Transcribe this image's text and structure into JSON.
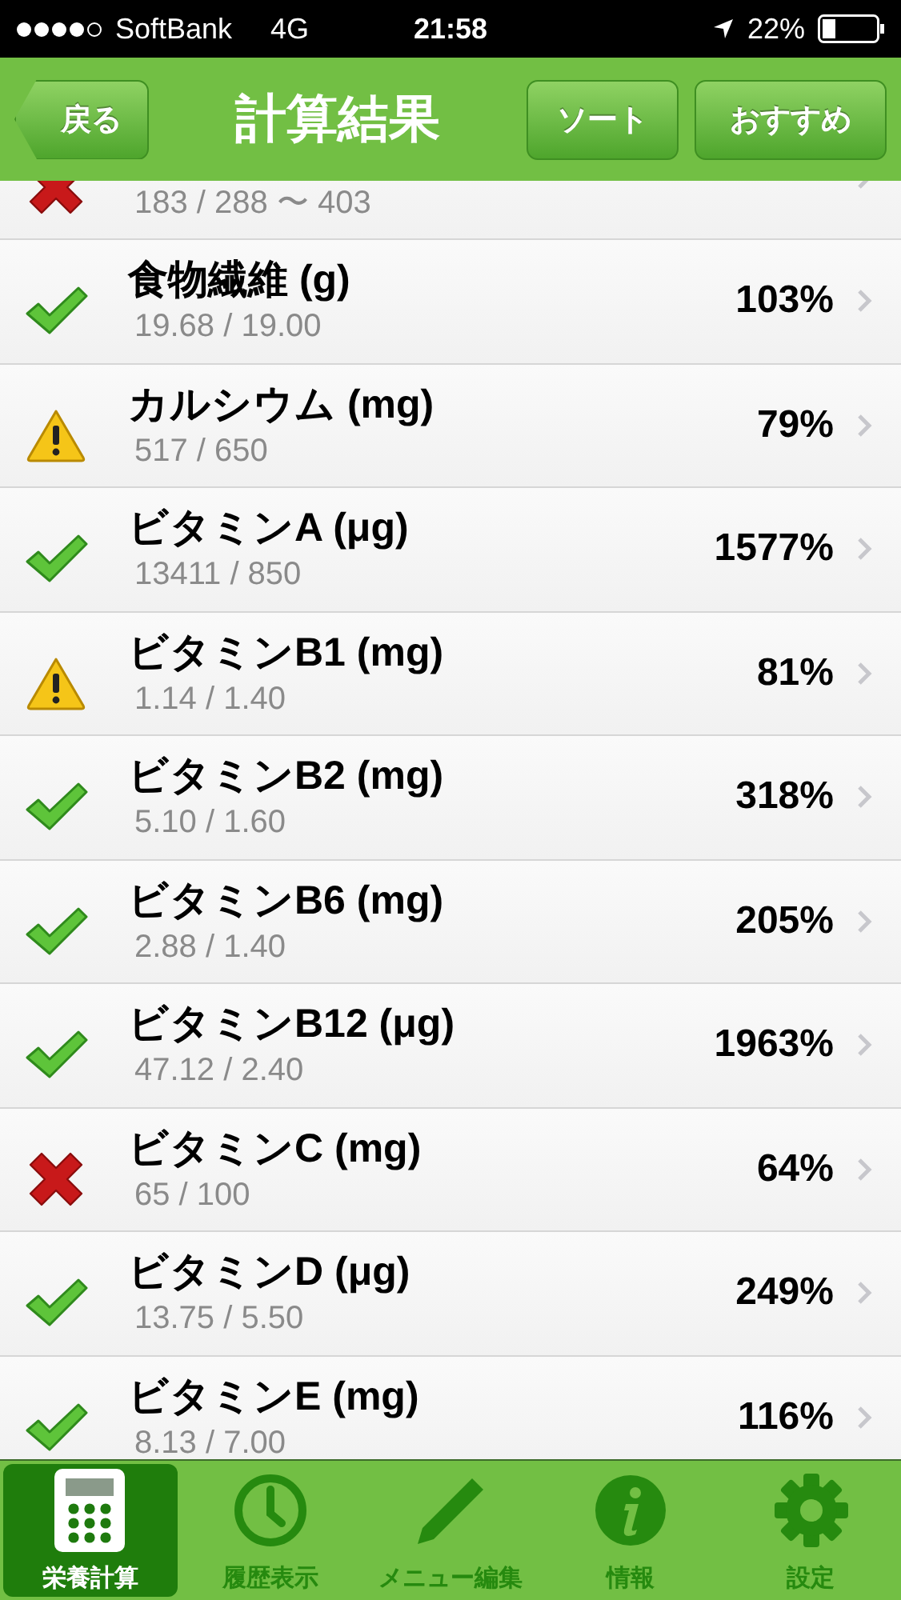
{
  "status_bar": {
    "carrier": "SoftBank",
    "network": "4G",
    "time": "21:58",
    "battery": "22%"
  },
  "nav_bar": {
    "back": "戻る",
    "title": "計算結果",
    "buttons": [
      "ソート",
      "おすすめ"
    ]
  },
  "rows": [
    {
      "kind": "bad",
      "detail": "183 / 288 〜 403"
    },
    {
      "kind": "ok",
      "name": "食物繊維 (g)",
      "detail": "19.68 / 19.00",
      "percent": "103%"
    },
    {
      "kind": "warn",
      "name": "カルシウム (mg)",
      "detail": "517 / 650",
      "percent": "79%"
    },
    {
      "kind": "ok",
      "name": "ビタミンA (μg)",
      "detail": "13411 / 850",
      "percent": "1577%"
    },
    {
      "kind": "warn",
      "name": "ビタミンB1 (mg)",
      "detail": "1.14 / 1.40",
      "percent": "81%"
    },
    {
      "kind": "ok",
      "name": "ビタミンB2 (mg)",
      "detail": "5.10 / 1.60",
      "percent": "318%"
    },
    {
      "kind": "ok",
      "name": "ビタミンB6 (mg)",
      "detail": "2.88 / 1.40",
      "percent": "205%"
    },
    {
      "kind": "ok",
      "name": "ビタミンB12 (μg)",
      "detail": "47.12 / 2.40",
      "percent": "1963%"
    },
    {
      "kind": "bad",
      "name": "ビタミンC (mg)",
      "detail": "65 / 100",
      "percent": "64%"
    },
    {
      "kind": "ok",
      "name": "ビタミンD (μg)",
      "detail": "13.75 / 5.50",
      "percent": "249%"
    },
    {
      "kind": "ok",
      "name": "ビタミンE (mg)",
      "detail": "8.13 / 7.00",
      "percent": "116%"
    }
  ],
  "tab_bar": [
    {
      "kind": "calculator",
      "label": "栄養計算",
      "selected": true
    },
    {
      "kind": "clock",
      "label": "履歴表示",
      "selected": false
    },
    {
      "kind": "pencil",
      "label": "メニュー編集",
      "selected": false
    },
    {
      "kind": "info",
      "label": "情報",
      "selected": false
    },
    {
      "kind": "gear",
      "label": "設定",
      "selected": false
    }
  ]
}
